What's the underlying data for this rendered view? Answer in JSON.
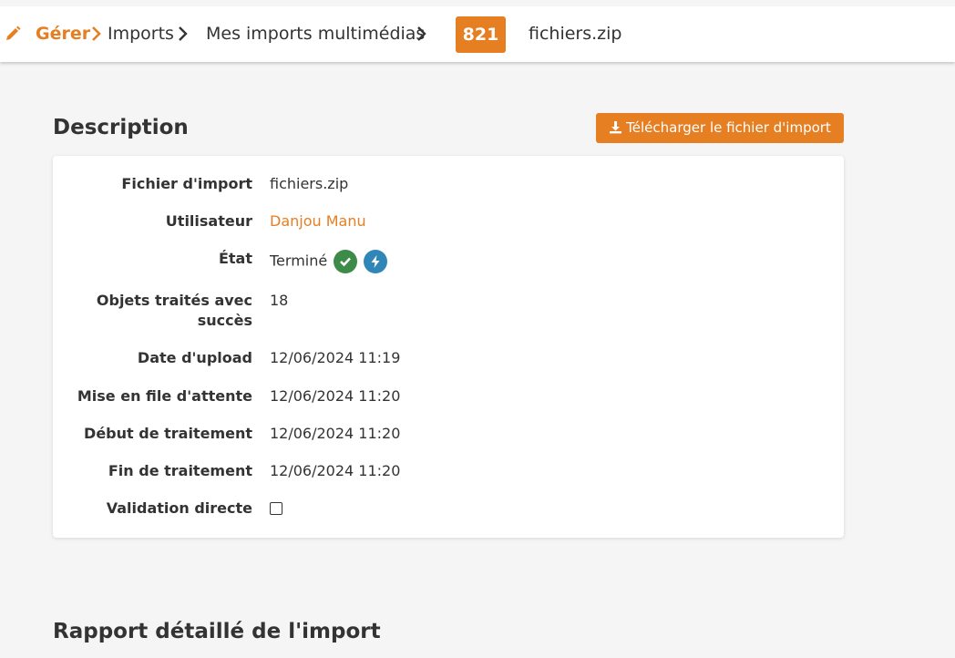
{
  "breadcrumb": {
    "gerer": "Gérer",
    "imports": "Imports",
    "multimedia": "Mes imports multimédias",
    "badge": "821",
    "filename": "fichiers.zip"
  },
  "description": {
    "title": "Description",
    "download_label": "Télécharger le fichier d'import"
  },
  "fields": {
    "fichier_label": "Fichier d'import",
    "fichier_value": "fichiers.zip",
    "user_label": "Utilisateur",
    "user_value": "Danjou Manu",
    "etat_label": "État",
    "etat_value": "Terminé",
    "objets_label_1": "Objets traités avec",
    "objets_label_2": "succès",
    "objets_value": "18",
    "upload_label": "Date d'upload",
    "upload_value": "12/06/2024 11:19",
    "file_label": "Mise en file d'attente",
    "file_value": "12/06/2024 11:20",
    "debut_label": "Début de traitement",
    "debut_value": "12/06/2024 11:20",
    "fin_label": "Fin de traitement",
    "fin_value": "12/06/2024 11:20",
    "validation_label": "Validation directe",
    "validation_checked": false
  },
  "report": {
    "title": "Rapport détaillé de l'import"
  },
  "colors": {
    "accent": "#e67e22",
    "success": "#3d8b48",
    "info": "#2f86b7"
  },
  "icons": [
    "pencil-icon",
    "chevron-right-icon",
    "download-icon",
    "check-circle-icon",
    "bolt-circle-icon"
  ]
}
